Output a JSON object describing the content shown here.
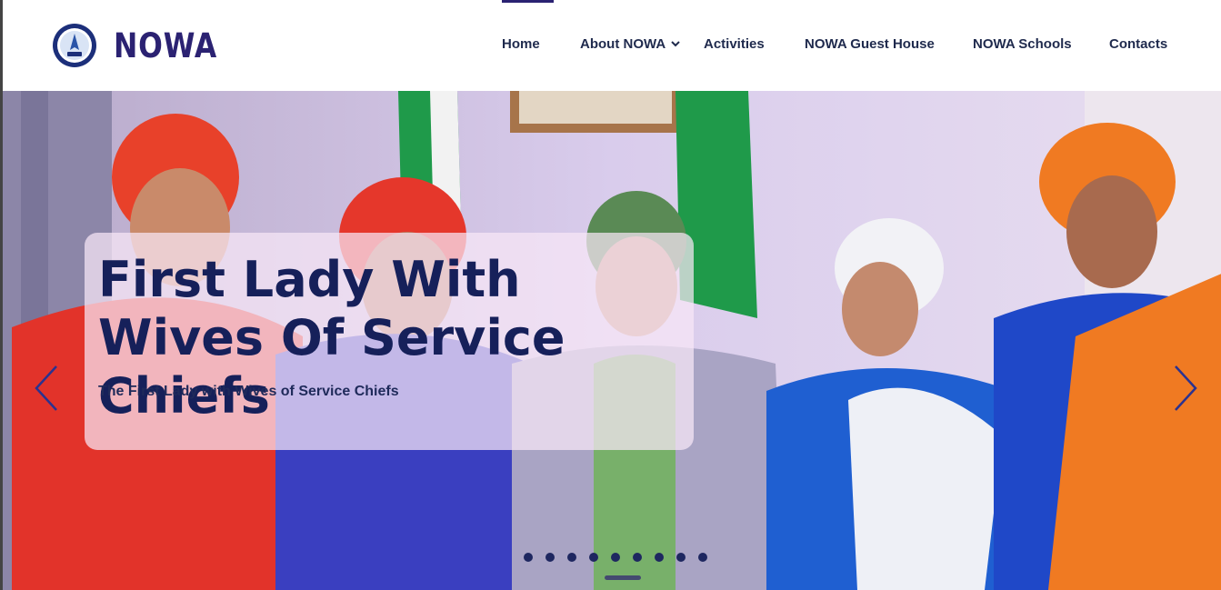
{
  "brand": {
    "name": "NOWA"
  },
  "nav": {
    "items": [
      {
        "label": "Home",
        "active": true
      },
      {
        "label": "About NOWA",
        "has_dropdown": true
      },
      {
        "label": "Activities"
      },
      {
        "label": "NOWA Guest House"
      },
      {
        "label": "NOWA Schools"
      },
      {
        "label": "Contacts"
      }
    ]
  },
  "hero": {
    "title": "First Lady With Wives Of Service Chiefs",
    "subtitle": "The First Lady with Wives of Service Chiefs",
    "slide_count": 9,
    "active_slide": 5
  },
  "colors": {
    "brand": "#2b2272",
    "nav_text": "#1f2a4d",
    "caption_text": "#16205a"
  }
}
